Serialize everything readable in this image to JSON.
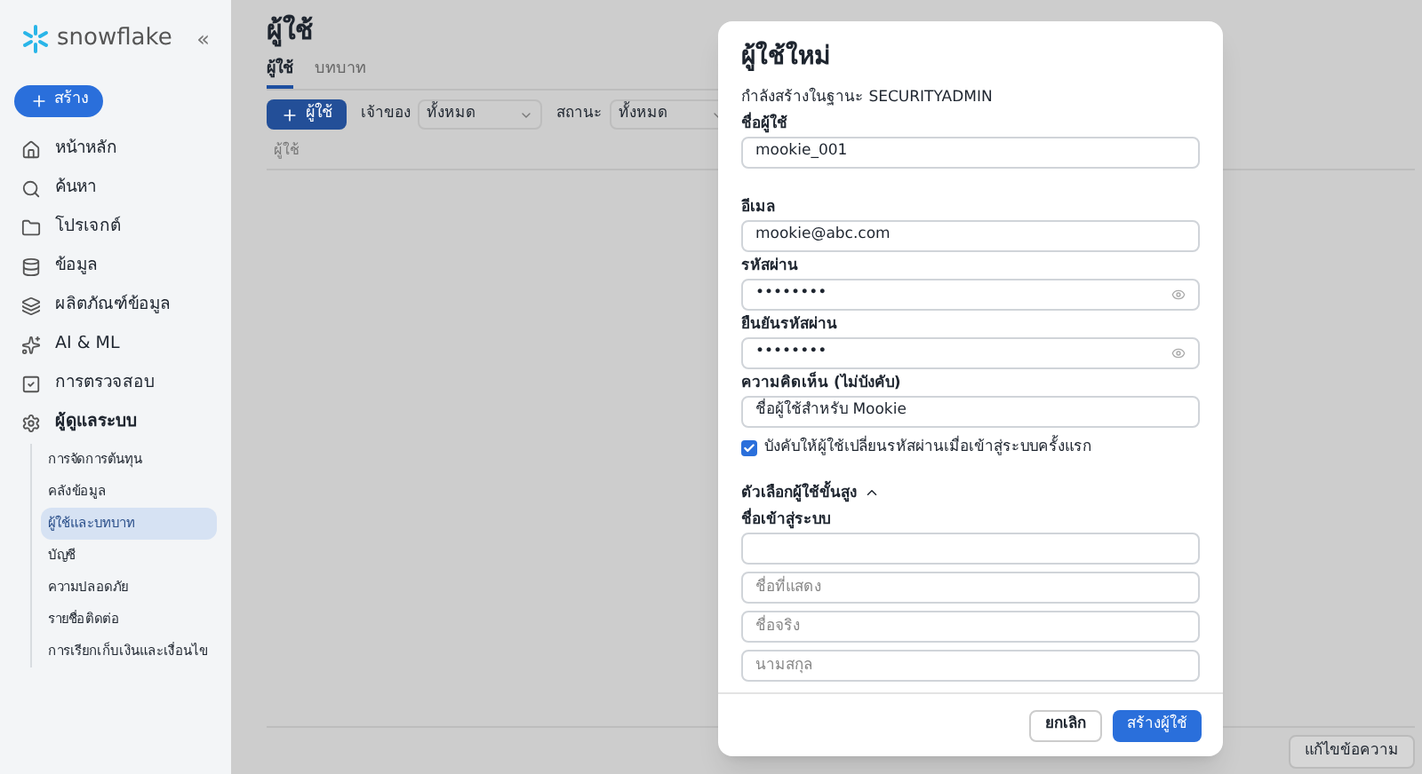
{
  "sidebar": {
    "logo": "snowflake",
    "collapse": "«",
    "create_button": "สร้าง",
    "items": [
      {
        "label": "หน้าหลัก",
        "expanded": false
      },
      {
        "label": "ค้นหา",
        "expanded": false
      },
      {
        "label": "โปรเจกต์",
        "expanded": false
      },
      {
        "label": "ข้อมูล",
        "expanded": false
      },
      {
        "label": "ผลิตภัณฑ์ข้อมูล",
        "expanded": false
      },
      {
        "label": "AI & ML",
        "expanded": false
      },
      {
        "label": "การตรวจสอบ",
        "expanded": false
      },
      {
        "label": "ผู้ดูแลระบบ",
        "expanded": true,
        "children": [
          {
            "label": "การจัดการต้นทุน",
            "selected": false
          },
          {
            "label": "คลังข้อมูล",
            "selected": false
          },
          {
            "label": "ผู้ใช้และบทบาท",
            "selected": true
          },
          {
            "label": "บัญชี",
            "selected": false
          },
          {
            "label": "ความปลอดภัย",
            "selected": false
          },
          {
            "label": "รายชื่อติดต่อ",
            "selected": false
          },
          {
            "label": "การเรียกเก็บเงินและเงื่อนไข",
            "selected": false
          }
        ]
      }
    ]
  },
  "page": {
    "title": "ผู้ใช้",
    "tabs": [
      {
        "label": "ผู้ใช้",
        "selected": true
      },
      {
        "label": "บทบาท",
        "selected": false
      }
    ],
    "add_button": "ผู้ใช้",
    "filters": [
      {
        "label": "เจ้าของ",
        "value": "ทั้งหมด"
      },
      {
        "label": "สถานะ",
        "value": "ทั้งหมด"
      }
    ],
    "table": {
      "columns": [
        "ผู้ใช้"
      ]
    },
    "feedback_button": "แก้ไขข้อความ"
  },
  "dialog": {
    "title": "ผู้ใช้ใหม่",
    "subtitle": "กำลังสร้างในฐานะ SECURITYADMIN",
    "fields": [
      {
        "kind": "text",
        "label": "ชื่อผู้ใช้",
        "value": "mookie_001"
      },
      {
        "kind": "text",
        "label": "อีเมล",
        "value": "mookie@abc.com"
      },
      {
        "kind": "password",
        "label": "รหัสผ่าน",
        "value": "••••••••"
      },
      {
        "kind": "password",
        "label": "ยืนยันรหัสผ่าน",
        "value": "••••••••"
      },
      {
        "kind": "text",
        "label": "ความคิดเห็น (ไม่บังคับ)",
        "value": "ชื่อผู้ใช้สำหรับ Mookie"
      }
    ],
    "checkbox": {
      "label": "บังคับให้ผู้ใช้เปลี่ยนรหัสผ่านเมื่อเข้าสู่ระบบครั้งแรก",
      "checked": true
    },
    "advanced": {
      "title": "ตัวเลือกผู้ใช้ขั้นสูง",
      "expanded": true,
      "label": "ชื่อเข้าสู่ระบบ",
      "fields": [
        {
          "placeholder": "ชื่อที่แสดง"
        },
        {
          "placeholder": "ชื่อจริง"
        },
        {
          "placeholder": "นามสกุล"
        }
      ]
    },
    "buttons": [
      {
        "kind": "secondary",
        "label": "ยกเลิก"
      },
      {
        "kind": "primary",
        "label": "สร้างผู้ใช้"
      }
    ]
  }
}
